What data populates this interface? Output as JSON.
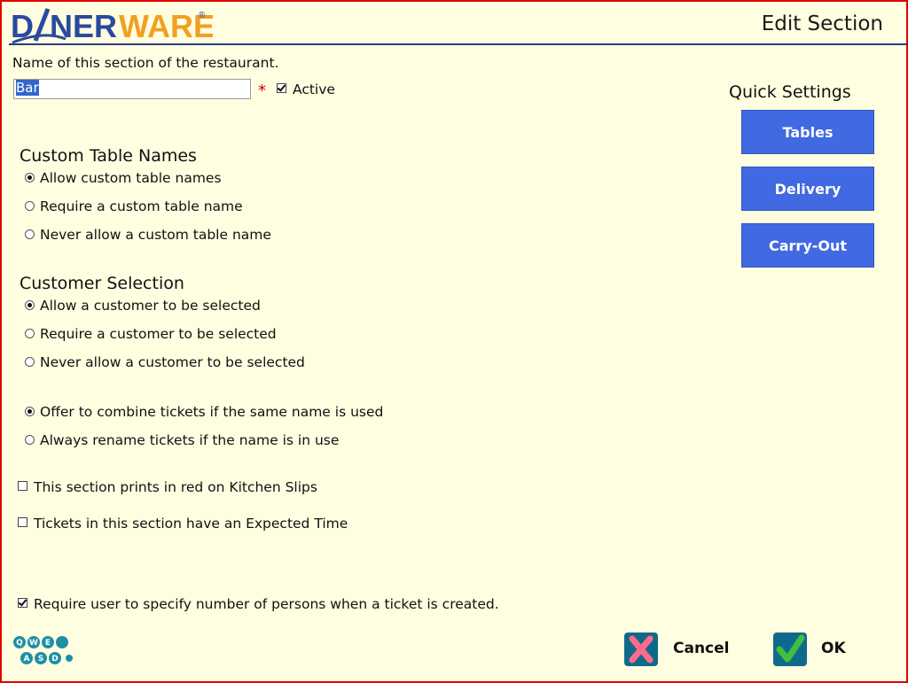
{
  "header": {
    "logo_text": "DINERWARE",
    "title": "Edit Section"
  },
  "name_section": {
    "label": "Name of this section of the restaurant.",
    "value": "Bar",
    "required_marker": "*",
    "active_label": "Active",
    "active_checked": true
  },
  "custom_table_names": {
    "heading": "Custom Table Names",
    "options": [
      {
        "label": "Allow custom table names",
        "checked": true
      },
      {
        "label": "Require a custom table name",
        "checked": false
      },
      {
        "label": "Never allow a custom table name",
        "checked": false
      }
    ]
  },
  "customer_selection": {
    "heading": "Customer Selection",
    "options": [
      {
        "label": "Allow a customer to be selected",
        "checked": true
      },
      {
        "label": "Require a customer to be selected",
        "checked": false
      },
      {
        "label": "Never allow a customer to be selected",
        "checked": false
      }
    ]
  },
  "ticket_naming": {
    "options": [
      {
        "label": "Offer to combine tickets if the same name is used",
        "checked": true
      },
      {
        "label": "Always rename tickets if the name is in use",
        "checked": false
      }
    ]
  },
  "checkboxes": {
    "red_print": {
      "label": "This section prints in red on Kitchen Slips",
      "checked": false
    },
    "expected_time": {
      "label": "Tickets in this section have an Expected Time",
      "checked": false
    },
    "persons": {
      "label": "Require user to specify number of persons when a ticket is created.",
      "checked": true
    }
  },
  "quick_settings": {
    "heading": "Quick Settings",
    "buttons": [
      "Tables",
      "Delivery",
      "Carry-Out"
    ]
  },
  "footer": {
    "keyboard_keys": [
      "Q",
      "W",
      "E",
      "A",
      "S",
      "D"
    ],
    "cancel_label": "Cancel",
    "ok_label": "OK"
  },
  "colors": {
    "background": "#fffee1",
    "border": "#e00000",
    "button_blue": "#4169e1",
    "logo_blue": "#2a4aa0",
    "logo_orange": "#f0a020"
  }
}
